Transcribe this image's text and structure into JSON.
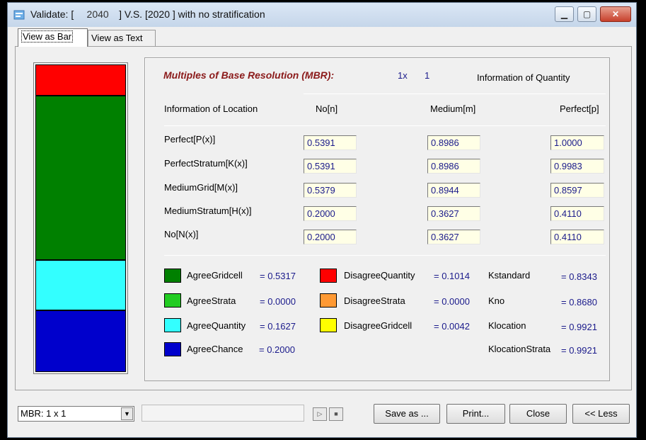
{
  "window": {
    "title_prefix": "Validate: [",
    "title_year": "2040",
    "title_suffix": "] V.S. [2020 ] with no stratification",
    "controls": {
      "minimize": "▁",
      "maximize": "▢",
      "close": "✕"
    }
  },
  "tabs": [
    "View as Bar",
    "View as Text"
  ],
  "bar": {
    "segments": [
      {
        "label": "DisagreeQuantity",
        "fraction": 0.1014,
        "color": "#ff0000"
      },
      {
        "label": "AgreeGridcell",
        "fraction": 0.5317,
        "color": "#008000"
      },
      {
        "label": "AgreeQuantity",
        "fraction": 0.1627,
        "color": "#33ffff"
      },
      {
        "label": "AgreeChance",
        "fraction": 0.2,
        "color": "#0000cc"
      }
    ]
  },
  "mbr": {
    "title": "Multiples of Base Resolution (MBR):",
    "x_label": "1x",
    "value": "1"
  },
  "table": {
    "quantity_title": "Information of Quantity",
    "location_title": "Information of Location",
    "columns": [
      "No[n]",
      "Medium[m]",
      "Perfect[p]"
    ],
    "rows": [
      {
        "label": "Perfect[P(x)]",
        "values": [
          "0.5391",
          "0.8986",
          "1.0000"
        ]
      },
      {
        "label": "PerfectStratum[K(x)]",
        "values": [
          "0.5391",
          "0.8986",
          "0.9983"
        ]
      },
      {
        "label": "MediumGrid[M(x)]",
        "values": [
          "0.5379",
          "0.8944",
          "0.8597"
        ]
      },
      {
        "label": "MediumStratum[H(x)]",
        "values": [
          "0.2000",
          "0.3627",
          "0.4110"
        ]
      },
      {
        "label": "No[N(x)]",
        "values": [
          "0.2000",
          "0.3627",
          "0.4110"
        ]
      }
    ]
  },
  "legend": {
    "col1": [
      {
        "label": "AgreeGridcell",
        "value": "= 0.5317",
        "color": "#008000"
      },
      {
        "label": "AgreeStrata",
        "value": "= 0.0000",
        "color": "#22cc22"
      },
      {
        "label": "AgreeQuantity",
        "value": "= 0.1627",
        "color": "#33ffff"
      },
      {
        "label": "AgreeChance",
        "value": "= 0.2000",
        "color": "#0000cc"
      }
    ],
    "col2": [
      {
        "label": "DisagreeQuantity",
        "value": "= 0.1014",
        "color": "#ff0000"
      },
      {
        "label": "DisagreeStrata",
        "value": "= 0.0000",
        "color": "#ff9933"
      },
      {
        "label": "DisagreeGridcell",
        "value": "= 0.0042",
        "color": "#ffff00"
      }
    ],
    "kappas": [
      {
        "label": "Kstandard",
        "value": "= 0.8343"
      },
      {
        "label": "Kno",
        "value": "= 0.8680"
      },
      {
        "label": "Klocation",
        "value": "= 0.9921"
      },
      {
        "label": "KlocationStrata",
        "value": "= 0.9921"
      }
    ]
  },
  "footer": {
    "mbr_select": "MBR: 1 x 1",
    "play_icon": "▷",
    "stop_icon": "■",
    "buttons": {
      "save": "Save as ...",
      "print": "Print...",
      "close": "Close",
      "less": "<< Less"
    }
  }
}
